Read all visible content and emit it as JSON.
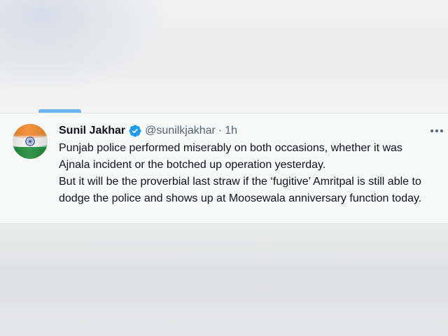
{
  "tweet": {
    "author_name": "Sunil Jakhar",
    "handle": "@sunilkjakhar",
    "separator": "·",
    "time": "1h",
    "text": "Punjab police performed miserably on both occasions, whether it was Ajnala incident or the botched up operation yesterday.\nBut it will be the proverbial last straw if the ‘fugitive’ Amritpal is still able to dodge the police and shows up at Moosewala anniversary function today.",
    "verified_icon": "verified-badge-icon",
    "more_icon": "more-options-icon",
    "avatar": "indian-flag-avatar"
  },
  "colors": {
    "verified": "#1d9bf0",
    "secondary_text": "#536471",
    "primary_text": "#0f1419",
    "tab_indicator": "#6fb3f0"
  }
}
